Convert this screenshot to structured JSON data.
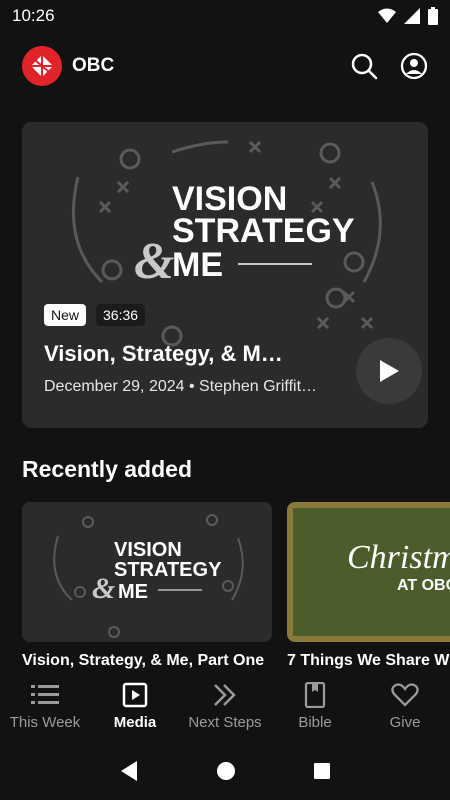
{
  "status_bar": {
    "time": "10:26"
  },
  "app_bar": {
    "title": "OBC"
  },
  "hero": {
    "art_lines": [
      "VISION",
      "STRATEGY",
      "&",
      "ME"
    ],
    "badge_new": "New",
    "duration": "36:36",
    "title": "Vision, Strategy, & M…",
    "subtitle": "December 29, 2024 • Stephen Griffit…"
  },
  "recently_added": {
    "title": "Recently added",
    "items": [
      {
        "label": "Vision, Strategy, & Me, Part One",
        "art_lines": [
          "VISION",
          "STRATEGY",
          "&",
          "ME"
        ]
      },
      {
        "label": "7 Things We Share W",
        "art_lines": [
          "Christm",
          "AT OBC"
        ]
      }
    ]
  },
  "bottom_nav": {
    "items": [
      {
        "label": "This Week",
        "icon": "list-icon"
      },
      {
        "label": "Media",
        "icon": "play-box-icon"
      },
      {
        "label": "Next Steps",
        "icon": "double-chevron-icon"
      },
      {
        "label": "Bible",
        "icon": "book-icon"
      },
      {
        "label": "Give",
        "icon": "heart-icon"
      }
    ],
    "active": "Media"
  },
  "colors": {
    "brand": "#e0242a",
    "background": "#121212",
    "card": "#2a2a2a",
    "christmas_green": "#4a5d2a"
  }
}
